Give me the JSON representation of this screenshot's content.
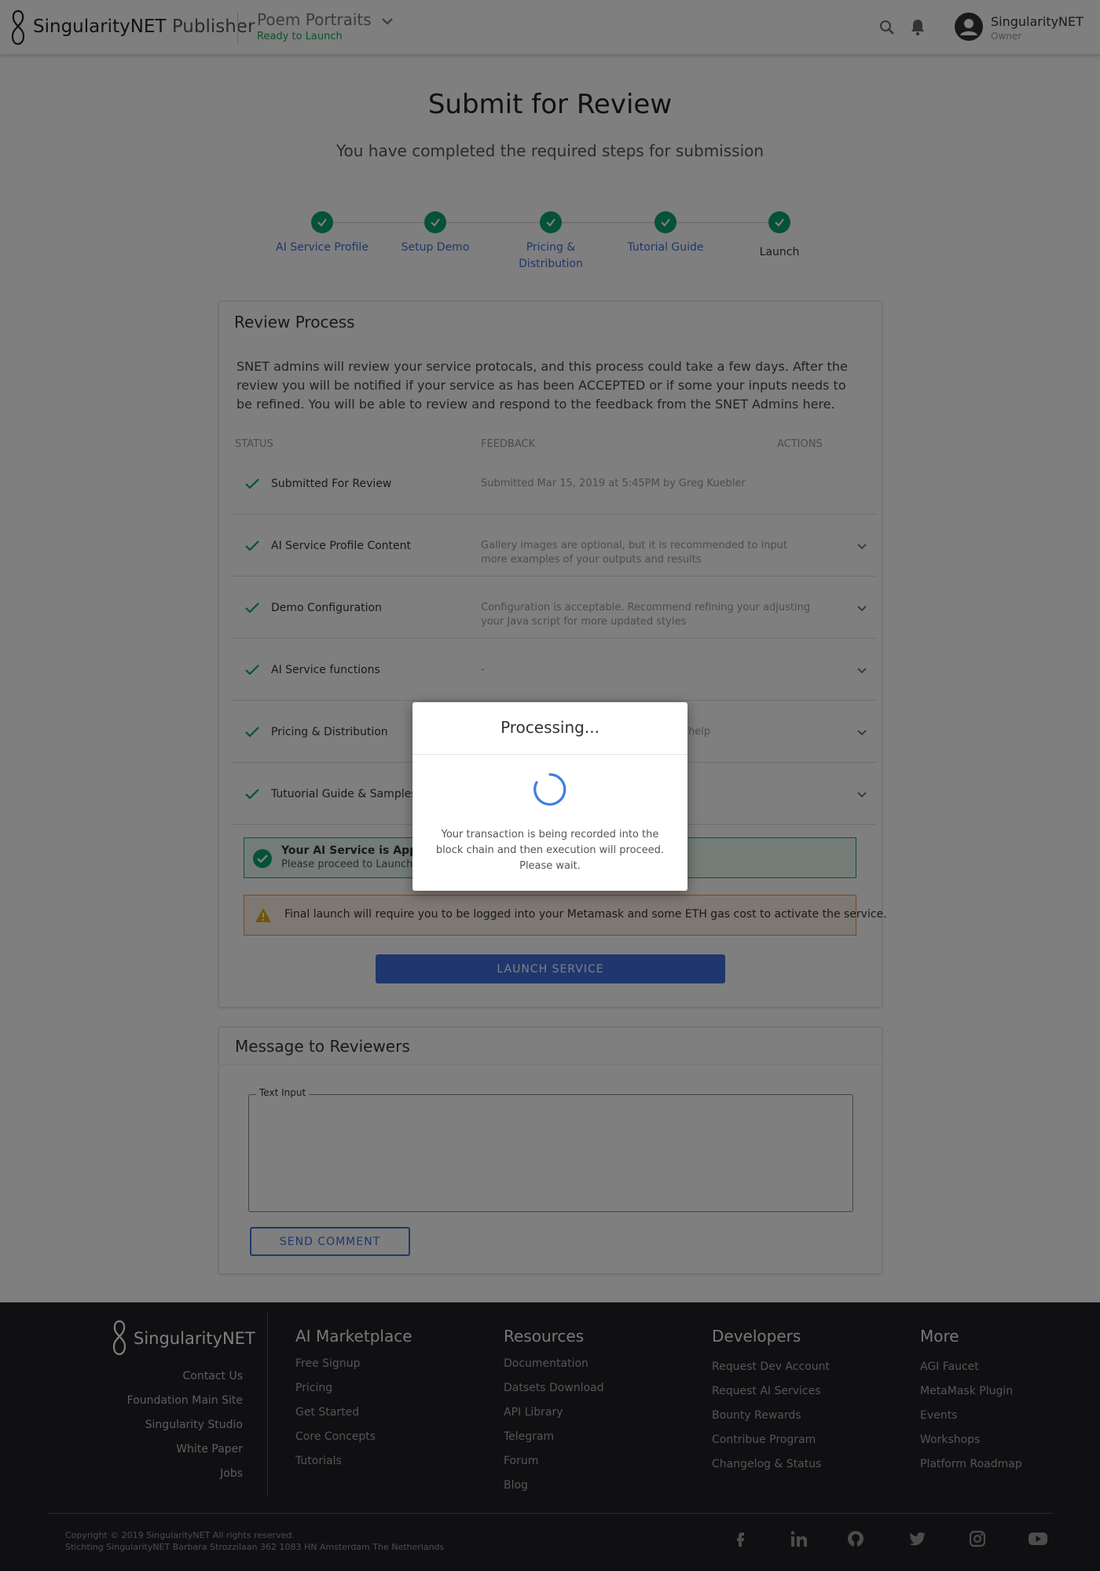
{
  "header": {
    "brand": "SingularityNET",
    "brand_suffix": "Publisher",
    "project_name": "Poem Portraits",
    "project_status": "Ready to Launch",
    "user_name": "SingularityNET",
    "user_role": "Owner"
  },
  "page": {
    "title": "Submit for Review",
    "subtitle": "You have completed the required steps for submission"
  },
  "stepper": [
    {
      "label": "AI Service Profile",
      "done": true
    },
    {
      "label": "Setup Demo",
      "done": true
    },
    {
      "label": "Pricing & Distribution",
      "done": true
    },
    {
      "label": "Tutorial Guide",
      "done": true
    },
    {
      "label": "Launch",
      "done": true
    }
  ],
  "review": {
    "title": "Review Process",
    "description": "SNET admins will review your service protocals, and this process could take a few days.  After the review you will be notified if your service as has been ACCEPTED or if some your inputs needs to be refined.  You will be able to review and respond to the feedback from the SNET Admins here.",
    "columns": {
      "status": "STATUS",
      "feedback": "FEEDBACK",
      "actions": "ACTIONS"
    },
    "rows": [
      {
        "status": "Submitted For Review",
        "feedback": "Submitted Mar 15, 2019 at 5:45PM by Greg Kuebler"
      },
      {
        "status": "AI Service Profile Content",
        "feedback": "Gallery images are optional, but it is recommended to input more examples of your outputs and results"
      },
      {
        "status": "Demo Configuration",
        "feedback": "Configuration is acceptable.  Recommend refining your adjusting your Java script for more updated styles"
      },
      {
        "status": "AI Service functions",
        "feedback": "-"
      },
      {
        "status": "Pricing & Distribution",
        "feedback": "help"
      },
      {
        "status": "Tutuorial Guide & Samples",
        "feedback": ""
      }
    ],
    "approved_title": "Your AI Service is Approv",
    "approved_sub": "Please proceed to Launch",
    "warning": "Final launch will require you to be logged into your Metamask and some ETH gas cost to activate the service.",
    "launch_button": "LAUNCH SERVICE"
  },
  "message": {
    "title": "Message to Reviewers",
    "field_label": "Text Input",
    "field_value": "",
    "send_button": "SEND COMMENT"
  },
  "footer": {
    "brand": "SingularityNET",
    "left_links": [
      "Contact Us",
      "Foundation Main Site",
      "Singularity Studio",
      "White Paper",
      "Jobs"
    ],
    "columns": [
      {
        "heading": "AI Marketplace",
        "links": [
          "Free Signup",
          "Pricing",
          "Get Started",
          "Core Concepts",
          "Tutorials"
        ]
      },
      {
        "heading": "Resources",
        "links": [
          "Documentation",
          "Datsets Download",
          "API Library",
          "Telegram",
          "Forum",
          "Blog"
        ]
      },
      {
        "heading": "Developers",
        "links": [
          "Request Dev Account",
          "Request AI Services",
          "Bounty Rewards",
          "Contribue Program",
          "Changelog & Status"
        ]
      },
      {
        "heading": "More",
        "links": [
          "AGI Faucet",
          "MetaMask Plugin",
          "Events",
          "Workshops",
          "Platform Roadmap"
        ]
      }
    ],
    "copyright": "Copyright © 2019 SingularityNET All rights reserved.",
    "address": "Stichting SingularityNET Barbara Strozzilaan 362 1083 HN Amsterdam The Netherlands",
    "social_icons": [
      "facebook-icon",
      "linkedin-icon",
      "github-icon",
      "twitter-icon",
      "instagram-icon",
      "youtube-icon"
    ]
  },
  "modal": {
    "title": "Processing...",
    "message": "Your transaction is being recorded into the block chain and then execution will proceed. Please wait."
  },
  "colors": {
    "accent": "#3e6fdc",
    "success": "#0aa375",
    "warning": "#e2955a",
    "footer_bg": "#202027"
  }
}
